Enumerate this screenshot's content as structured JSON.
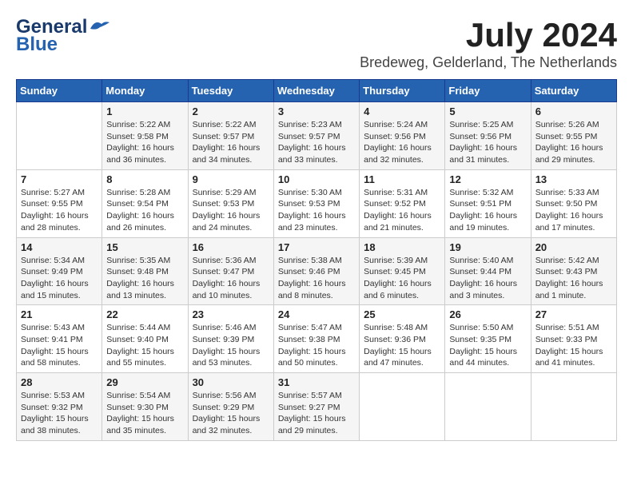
{
  "header": {
    "logo_line1": "General",
    "logo_line2": "Blue",
    "month": "July 2024",
    "location": "Bredeweg, Gelderland, The Netherlands"
  },
  "weekdays": [
    "Sunday",
    "Monday",
    "Tuesday",
    "Wednesday",
    "Thursday",
    "Friday",
    "Saturday"
  ],
  "weeks": [
    [
      {
        "day": "",
        "info": ""
      },
      {
        "day": "1",
        "info": "Sunrise: 5:22 AM\nSunset: 9:58 PM\nDaylight: 16 hours\nand 36 minutes."
      },
      {
        "day": "2",
        "info": "Sunrise: 5:22 AM\nSunset: 9:57 PM\nDaylight: 16 hours\nand 34 minutes."
      },
      {
        "day": "3",
        "info": "Sunrise: 5:23 AM\nSunset: 9:57 PM\nDaylight: 16 hours\nand 33 minutes."
      },
      {
        "day": "4",
        "info": "Sunrise: 5:24 AM\nSunset: 9:56 PM\nDaylight: 16 hours\nand 32 minutes."
      },
      {
        "day": "5",
        "info": "Sunrise: 5:25 AM\nSunset: 9:56 PM\nDaylight: 16 hours\nand 31 minutes."
      },
      {
        "day": "6",
        "info": "Sunrise: 5:26 AM\nSunset: 9:55 PM\nDaylight: 16 hours\nand 29 minutes."
      }
    ],
    [
      {
        "day": "7",
        "info": "Sunrise: 5:27 AM\nSunset: 9:55 PM\nDaylight: 16 hours\nand 28 minutes."
      },
      {
        "day": "8",
        "info": "Sunrise: 5:28 AM\nSunset: 9:54 PM\nDaylight: 16 hours\nand 26 minutes."
      },
      {
        "day": "9",
        "info": "Sunrise: 5:29 AM\nSunset: 9:53 PM\nDaylight: 16 hours\nand 24 minutes."
      },
      {
        "day": "10",
        "info": "Sunrise: 5:30 AM\nSunset: 9:53 PM\nDaylight: 16 hours\nand 23 minutes."
      },
      {
        "day": "11",
        "info": "Sunrise: 5:31 AM\nSunset: 9:52 PM\nDaylight: 16 hours\nand 21 minutes."
      },
      {
        "day": "12",
        "info": "Sunrise: 5:32 AM\nSunset: 9:51 PM\nDaylight: 16 hours\nand 19 minutes."
      },
      {
        "day": "13",
        "info": "Sunrise: 5:33 AM\nSunset: 9:50 PM\nDaylight: 16 hours\nand 17 minutes."
      }
    ],
    [
      {
        "day": "14",
        "info": "Sunrise: 5:34 AM\nSunset: 9:49 PM\nDaylight: 16 hours\nand 15 minutes."
      },
      {
        "day": "15",
        "info": "Sunrise: 5:35 AM\nSunset: 9:48 PM\nDaylight: 16 hours\nand 13 minutes."
      },
      {
        "day": "16",
        "info": "Sunrise: 5:36 AM\nSunset: 9:47 PM\nDaylight: 16 hours\nand 10 minutes."
      },
      {
        "day": "17",
        "info": "Sunrise: 5:38 AM\nSunset: 9:46 PM\nDaylight: 16 hours\nand 8 minutes."
      },
      {
        "day": "18",
        "info": "Sunrise: 5:39 AM\nSunset: 9:45 PM\nDaylight: 16 hours\nand 6 minutes."
      },
      {
        "day": "19",
        "info": "Sunrise: 5:40 AM\nSunset: 9:44 PM\nDaylight: 16 hours\nand 3 minutes."
      },
      {
        "day": "20",
        "info": "Sunrise: 5:42 AM\nSunset: 9:43 PM\nDaylight: 16 hours\nand 1 minute."
      }
    ],
    [
      {
        "day": "21",
        "info": "Sunrise: 5:43 AM\nSunset: 9:41 PM\nDaylight: 15 hours\nand 58 minutes."
      },
      {
        "day": "22",
        "info": "Sunrise: 5:44 AM\nSunset: 9:40 PM\nDaylight: 15 hours\nand 55 minutes."
      },
      {
        "day": "23",
        "info": "Sunrise: 5:46 AM\nSunset: 9:39 PM\nDaylight: 15 hours\nand 53 minutes."
      },
      {
        "day": "24",
        "info": "Sunrise: 5:47 AM\nSunset: 9:38 PM\nDaylight: 15 hours\nand 50 minutes."
      },
      {
        "day": "25",
        "info": "Sunrise: 5:48 AM\nSunset: 9:36 PM\nDaylight: 15 hours\nand 47 minutes."
      },
      {
        "day": "26",
        "info": "Sunrise: 5:50 AM\nSunset: 9:35 PM\nDaylight: 15 hours\nand 44 minutes."
      },
      {
        "day": "27",
        "info": "Sunrise: 5:51 AM\nSunset: 9:33 PM\nDaylight: 15 hours\nand 41 minutes."
      }
    ],
    [
      {
        "day": "28",
        "info": "Sunrise: 5:53 AM\nSunset: 9:32 PM\nDaylight: 15 hours\nand 38 minutes."
      },
      {
        "day": "29",
        "info": "Sunrise: 5:54 AM\nSunset: 9:30 PM\nDaylight: 15 hours\nand 35 minutes."
      },
      {
        "day": "30",
        "info": "Sunrise: 5:56 AM\nSunset: 9:29 PM\nDaylight: 15 hours\nand 32 minutes."
      },
      {
        "day": "31",
        "info": "Sunrise: 5:57 AM\nSunset: 9:27 PM\nDaylight: 15 hours\nand 29 minutes."
      },
      {
        "day": "",
        "info": ""
      },
      {
        "day": "",
        "info": ""
      },
      {
        "day": "",
        "info": ""
      }
    ]
  ]
}
